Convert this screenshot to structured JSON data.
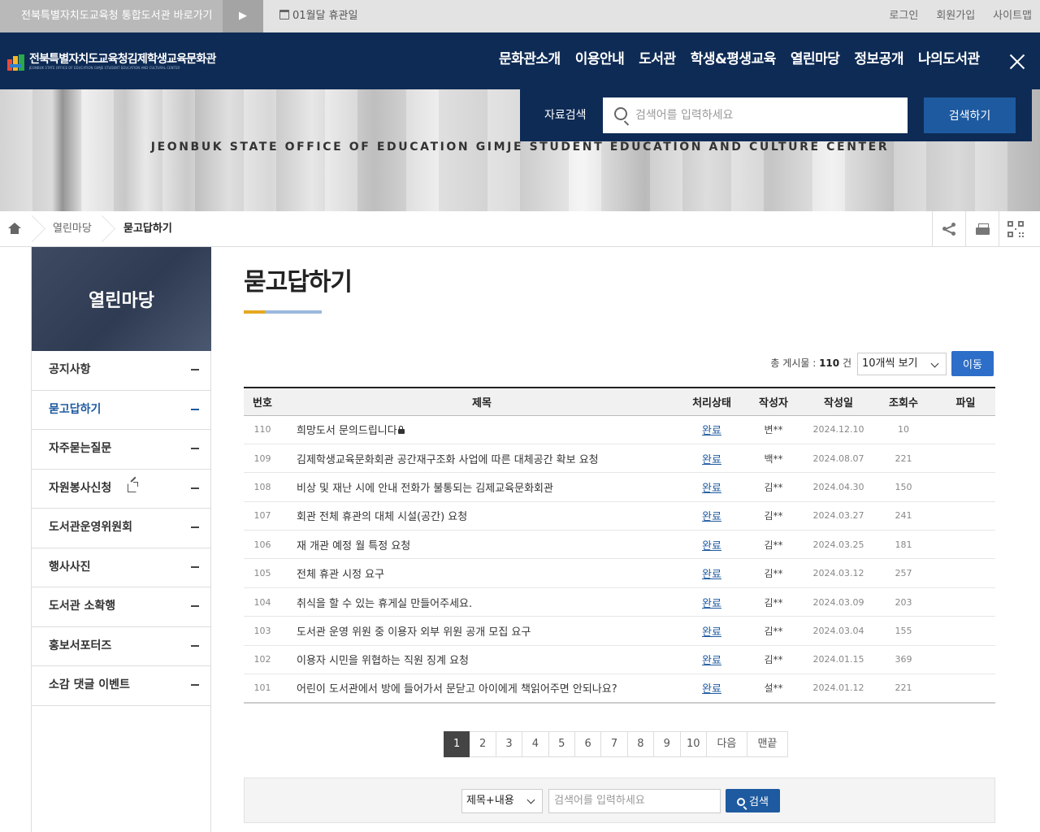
{
  "topbar": {
    "portal_link": "전북특별자치도교육청 통합도서관 바로가기",
    "arrow": "▶",
    "closed_day": "01월달 휴관일",
    "login": "로그인",
    "signup": "회원가입",
    "sitemap": "사이트맵"
  },
  "header": {
    "logo_title": "전북특별자치도교육청김제학생교육문화관",
    "logo_sub": "JEONBUK STATE OFFICE OF EDUCATION GIMJE STUDENT EDUCATION AND CULTURAL CENTER",
    "nav": [
      "문화관소개",
      "이용안내",
      "도서관",
      "학생&평생교육",
      "열린마당",
      "정보공개",
      "나의도서관"
    ]
  },
  "banner": {
    "tagline": "JEONBUK STATE OFFICE OF EDUCATION GIMJE STUDENT EDUCATION AND CULTURE CENTER",
    "search_label": "자료검색",
    "search_placeholder": "검색어를 입력하세요",
    "search_button": "검색하기"
  },
  "breadcrumb": {
    "level1": "열린마당",
    "current": "묻고답하기"
  },
  "sidebar": {
    "title": "열린마당",
    "items": [
      {
        "label": "공지사항",
        "active": false
      },
      {
        "label": "묻고답하기",
        "active": true
      },
      {
        "label": "자주묻는질문",
        "active": false
      },
      {
        "label": "자원봉사신청",
        "active": false,
        "external": true
      },
      {
        "label": "도서관운영위원회",
        "active": false
      },
      {
        "label": "행사사진",
        "active": false
      },
      {
        "label": "도서관 소확행",
        "active": false
      },
      {
        "label": "홍보서포터즈",
        "active": false
      },
      {
        "label": "소감 댓글 이벤트",
        "active": false
      }
    ]
  },
  "content": {
    "title": "묻고답하기",
    "total_prefix": "총 게시물 : ",
    "total_count": "110",
    "total_suffix": " 건",
    "per_page": "10개씩 보기",
    "go_button": "이동"
  },
  "board": {
    "headers": [
      "번호",
      "제목",
      "처리상태",
      "작성자",
      "작성일",
      "조회수",
      "파일"
    ],
    "rows": [
      {
        "no": "110",
        "title": "희망도서 문의드립니다",
        "locked": true,
        "status": "완료",
        "writer": "변**",
        "date": "2024.12.10",
        "views": "10"
      },
      {
        "no": "109",
        "title": "김제학생교육문화회관 공간재구조화 사업에 따른 대체공간 확보 요청",
        "locked": false,
        "status": "완료",
        "writer": "백**",
        "date": "2024.08.07",
        "views": "221"
      },
      {
        "no": "108",
        "title": "비상 및 재난 시에 안내 전화가 불통되는 김제교육문화회관",
        "locked": false,
        "status": "완료",
        "writer": "김**",
        "date": "2024.04.30",
        "views": "150"
      },
      {
        "no": "107",
        "title": "회관 전체 휴관의 대체 시설(공간) 요청",
        "locked": false,
        "status": "완료",
        "writer": "김**",
        "date": "2024.03.27",
        "views": "241"
      },
      {
        "no": "106",
        "title": "재 개관 예정 월 특정 요청",
        "locked": false,
        "status": "완료",
        "writer": "김**",
        "date": "2024.03.25",
        "views": "181"
      },
      {
        "no": "105",
        "title": "전체 휴관 시정 요구",
        "locked": false,
        "status": "완료",
        "writer": "김**",
        "date": "2024.03.12",
        "views": "257"
      },
      {
        "no": "104",
        "title": "취식을 할 수 있는 휴게실 만들어주세요.",
        "locked": false,
        "status": "완료",
        "writer": "김**",
        "date": "2024.03.09",
        "views": "203"
      },
      {
        "no": "103",
        "title": "도서관 운영 위원 중 이용자 외부 위원 공개 모집 요구",
        "locked": false,
        "status": "완료",
        "writer": "김**",
        "date": "2024.03.04",
        "views": "155"
      },
      {
        "no": "102",
        "title": "이용자 시민을 위협하는 직원 징계 요청",
        "locked": false,
        "status": "완료",
        "writer": "김**",
        "date": "2024.01.15",
        "views": "369"
      },
      {
        "no": "101",
        "title": "어린이 도서관에서 방에 들어가서 문닫고 아이에게 책읽어주면 안되나요?",
        "locked": false,
        "status": "완료",
        "writer": "설**",
        "date": "2024.01.12",
        "views": "221"
      }
    ]
  },
  "pagination": {
    "pages": [
      "1",
      "2",
      "3",
      "4",
      "5",
      "6",
      "7",
      "8",
      "9",
      "10"
    ],
    "current": "1",
    "next": "다음",
    "last": "맨끝"
  },
  "bottom_search": {
    "field": "제목+내용",
    "placeholder": "검색어를 입력하세요",
    "button": "검색"
  },
  "colors": {
    "header_navy": "#0e2b55",
    "accent_blue": "#1e5aa0",
    "title_bar_orange": "#e5a823",
    "title_bar_blue": "#9bb8dc"
  }
}
